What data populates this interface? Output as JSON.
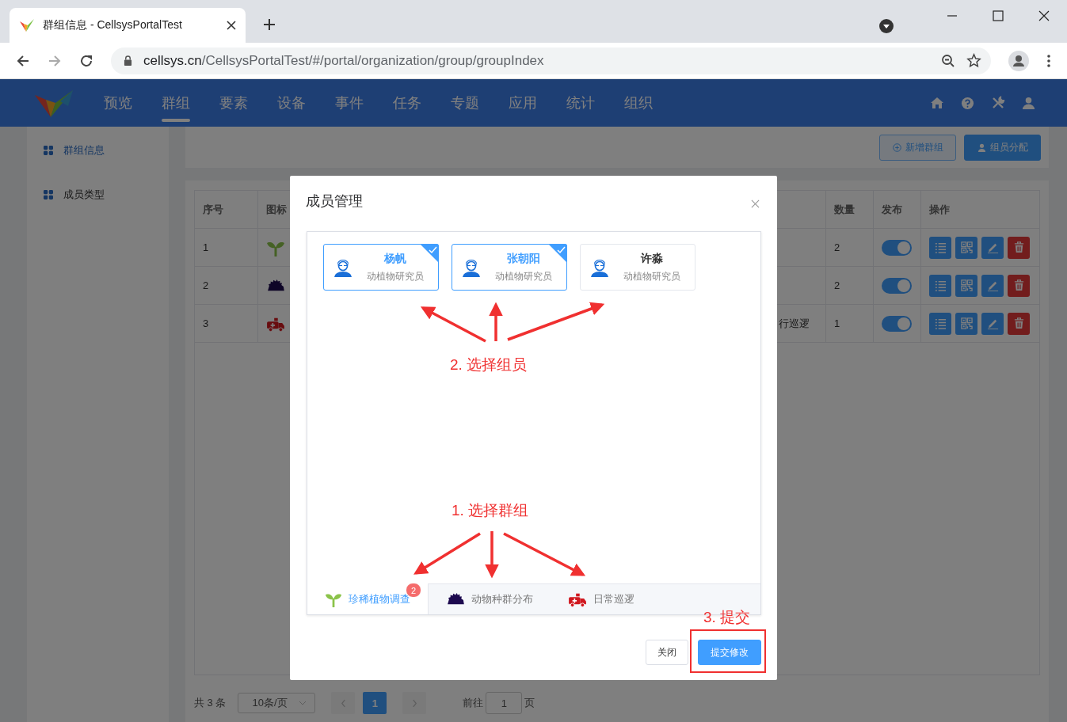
{
  "browser": {
    "tab_title": "群组信息 - CellsysPortalTest",
    "url_host": "cellsys.cn",
    "url_path": "/CellsysPortalTest/#/portal/organization/group/groupIndex"
  },
  "nav": {
    "items": [
      {
        "label": "预览",
        "selected": false
      },
      {
        "label": "群组",
        "selected": true
      },
      {
        "label": "要素",
        "selected": false
      },
      {
        "label": "设备",
        "selected": false
      },
      {
        "label": "事件",
        "selected": false
      },
      {
        "label": "任务",
        "selected": false
      },
      {
        "label": "专题",
        "selected": false
      },
      {
        "label": "应用",
        "selected": false
      },
      {
        "label": "统计",
        "selected": false
      },
      {
        "label": "组织",
        "selected": false
      }
    ]
  },
  "sidebar": {
    "items": [
      {
        "label": "群组信息",
        "selected": true
      },
      {
        "label": "成员类型",
        "selected": false
      }
    ]
  },
  "toolbar": {
    "buttons": [
      {
        "label": "新增群组",
        "kind": "outline"
      },
      {
        "label": "组员分配",
        "kind": "primary"
      }
    ]
  },
  "table": {
    "columns": [
      "序号",
      "图标",
      "数量",
      "发布",
      "操作"
    ],
    "rows": [
      {
        "index": "1",
        "count": "2",
        "published": true
      },
      {
        "index": "2",
        "count": "2",
        "published": true
      },
      {
        "index": "3",
        "column_3": "行巡逻",
        "count": "1",
        "published": true
      }
    ]
  },
  "pagination": {
    "total": "共 3 条",
    "page_size": "10条/页",
    "pages": [
      {
        "label": "1",
        "selected": true
      }
    ],
    "goto_label": "前往",
    "goto_value": "1",
    "goto_suffix": "页"
  },
  "dialog": {
    "title": "成员管理",
    "members": [
      {
        "name": "杨帆",
        "role": "动植物研究员",
        "selected": true
      },
      {
        "name": "张朝阳",
        "role": "动植物研究员",
        "selected": true
      },
      {
        "name": "许淼",
        "role": "动植物研究员",
        "selected": false
      }
    ],
    "groups": [
      {
        "name": "珍稀植物调查",
        "selected": true,
        "badge": "2"
      },
      {
        "name": "动物种群分布",
        "selected": false
      },
      {
        "name": "日常巡逻",
        "selected": false
      }
    ],
    "buttons": [
      {
        "label": "关闭",
        "kind": "default"
      },
      {
        "label": "提交修改",
        "kind": "primary"
      }
    ]
  },
  "annotations": {
    "select_members": "2. 选择组员",
    "select_group": "1. 选择群组",
    "submit": "3. 提交"
  }
}
